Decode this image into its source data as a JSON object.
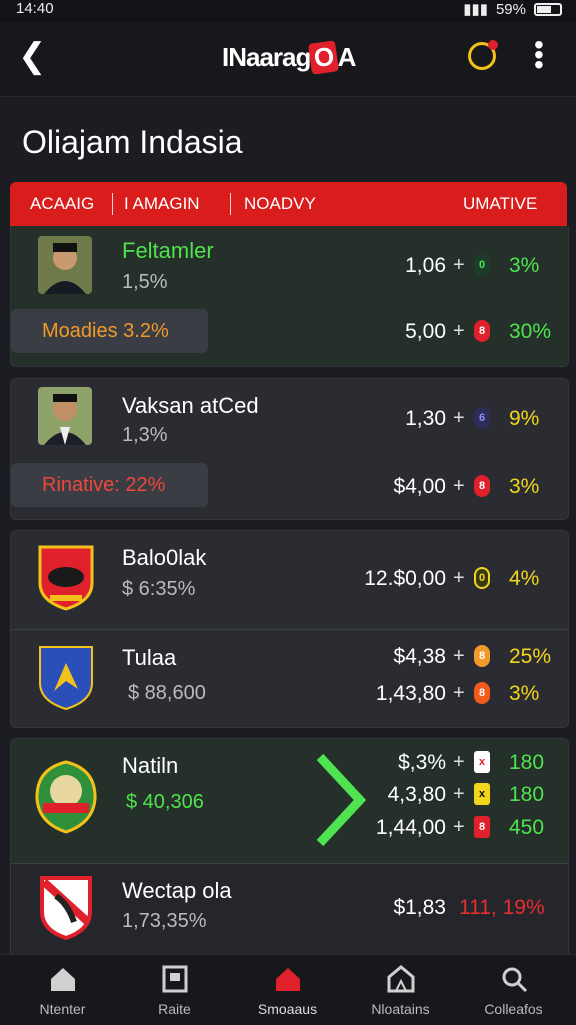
{
  "status": {
    "time": "14:40",
    "battery": "59%"
  },
  "app": {
    "title_prefix": "INaarag",
    "title_logo": "O",
    "title_suffix": "A"
  },
  "page_title": "Oliajam Indasia",
  "table_header": {
    "col1": "ACAAIG",
    "col2": "I AMAGIN",
    "col3": "NOADVY",
    "col4": "UMATIVE"
  },
  "rows": [
    {
      "name": "Feltamler",
      "sub": "1,5%",
      "pill": "Moadies 3.2%",
      "lines": [
        {
          "value": "1,06",
          "badge": "0",
          "pct": "3%"
        },
        {
          "value": "5,00",
          "badge": "8",
          "pct": "30%"
        }
      ]
    },
    {
      "name": "Vaksan atCed",
      "sub": "1,3%",
      "pill": "Rinative: 22%",
      "lines": [
        {
          "value": "1,30",
          "badge": "6",
          "pct": "9%"
        },
        {
          "value": "$4,00",
          "badge": "8",
          "pct": "3%"
        }
      ]
    },
    {
      "name": "Balo0lak",
      "sub": "$ 6:35%",
      "lines": [
        {
          "value": "12.$0,00",
          "badge": "0",
          "pct": "4%"
        }
      ]
    },
    {
      "name": "Tulaa",
      "sub": "$ 88,600",
      "lines": [
        {
          "value": "$4,38",
          "badge": "8",
          "pct": "25%"
        },
        {
          "value": "1,43,80",
          "badge": "8",
          "pct": "3%"
        }
      ]
    },
    {
      "name": "Natiln",
      "sub": "$ 40,306",
      "lines": [
        {
          "value": "$,3%",
          "badge": "x",
          "pct": "180"
        },
        {
          "value": "4,3,80",
          "badge": "x",
          "pct": "180"
        },
        {
          "value": "1,44,00",
          "badge": "8",
          "pct": "450"
        }
      ]
    },
    {
      "name": "Wectap ola",
      "sub": "1,73,35%",
      "lines": [
        {
          "value": "$1,83",
          "pct": "111, 19%"
        }
      ]
    }
  ],
  "nav": [
    {
      "label": "Ntenter",
      "icon": "home-icon"
    },
    {
      "label": "Raite",
      "icon": "document-icon"
    },
    {
      "label": "Smoaaus",
      "icon": "home-icon"
    },
    {
      "label": "Nloatains",
      "icon": "building-icon"
    },
    {
      "label": "Colleafos",
      "icon": "search-icon"
    }
  ],
  "colors": {
    "accent": "#d91c1c",
    "green": "#4fe34f",
    "yellow": "#f2d61b",
    "orange": "#f09a2a"
  }
}
